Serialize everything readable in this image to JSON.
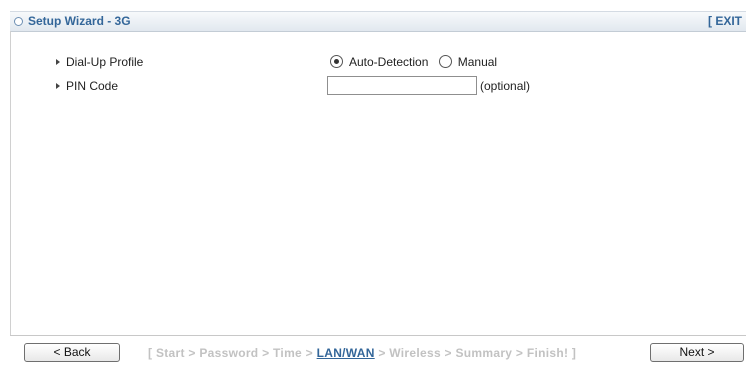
{
  "header": {
    "title": "Setup Wizard - 3G",
    "exit_label": "[ EXIT"
  },
  "form": {
    "dialup": {
      "label": "Dial-Up Profile",
      "options": [
        {
          "label": "Auto-Detection",
          "checked": true
        },
        {
          "label": "Manual",
          "checked": false
        }
      ]
    },
    "pin": {
      "label": "PIN Code",
      "value": "",
      "hint": "(optional)"
    }
  },
  "footer": {
    "back_label": "< Back",
    "next_label": "Next >",
    "steps": {
      "open": "[ ",
      "before": "Start > Password > Time > ",
      "current": "LAN/WAN",
      "after": " > Wireless > Summary > Finish!",
      "close": " ]"
    }
  },
  "colors": {
    "accent": "#336699",
    "inactive_step": "#c2c2c2"
  }
}
